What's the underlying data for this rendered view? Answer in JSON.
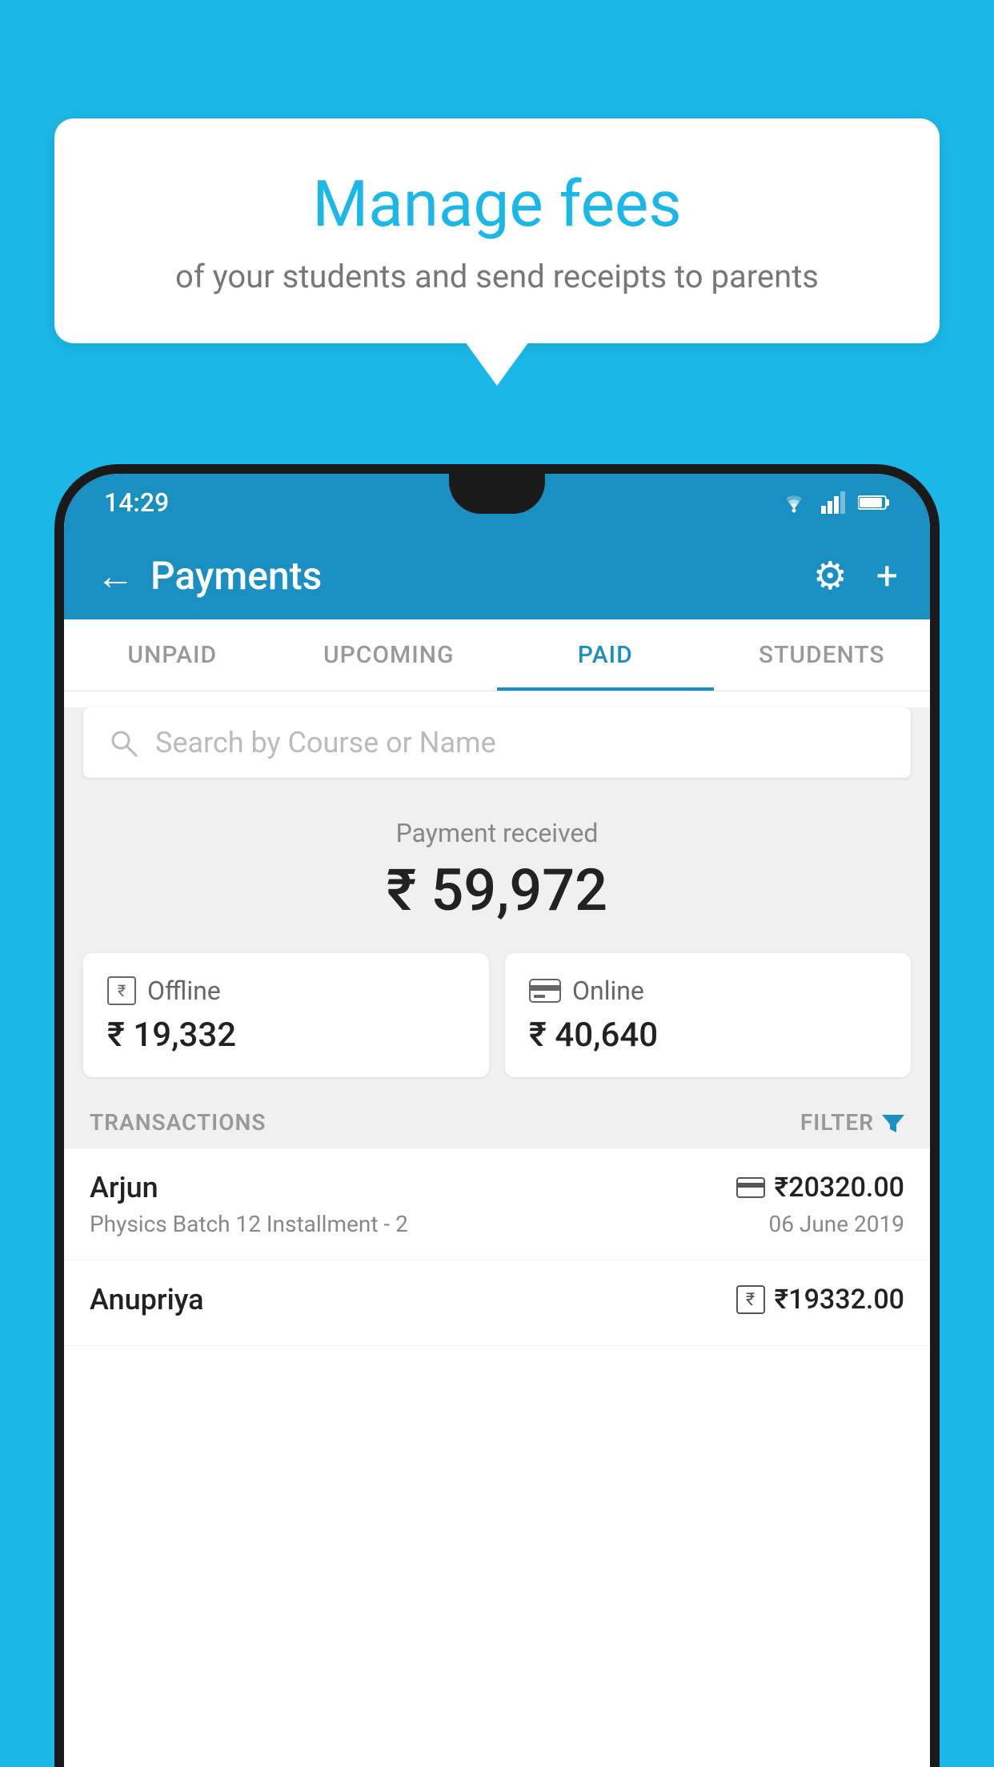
{
  "background_color": "#1ab8e8",
  "speech_bubble": {
    "title": "Manage fees",
    "subtitle": "of your students and send receipts to parents"
  },
  "status_bar": {
    "time": "14:29",
    "icons": [
      "wifi",
      "signal",
      "battery"
    ]
  },
  "app_bar": {
    "title": "Payments",
    "back_label": "←",
    "gear_icon": "⚙",
    "plus_icon": "+"
  },
  "tabs": [
    {
      "label": "UNPAID",
      "active": false
    },
    {
      "label": "UPCOMING",
      "active": false
    },
    {
      "label": "PAID",
      "active": true
    },
    {
      "label": "STUDENTS",
      "active": false
    }
  ],
  "search": {
    "placeholder": "Search by Course or Name"
  },
  "payment_received": {
    "label": "Payment received",
    "amount": "₹ 59,972"
  },
  "payment_cards": [
    {
      "type": "Offline",
      "amount": "₹ 19,332",
      "icon": "rupee"
    },
    {
      "type": "Online",
      "amount": "₹ 40,640",
      "icon": "card"
    }
  ],
  "transactions_section": {
    "label": "TRANSACTIONS",
    "filter_label": "FILTER"
  },
  "transactions": [
    {
      "name": "Arjun",
      "course": "Physics Batch 12 Installment - 2",
      "amount": "₹20320.00",
      "date": "06 June 2019",
      "payment_type": "card"
    },
    {
      "name": "Anupriya",
      "course": "",
      "amount": "₹19332.00",
      "date": "",
      "payment_type": "cash"
    }
  ]
}
